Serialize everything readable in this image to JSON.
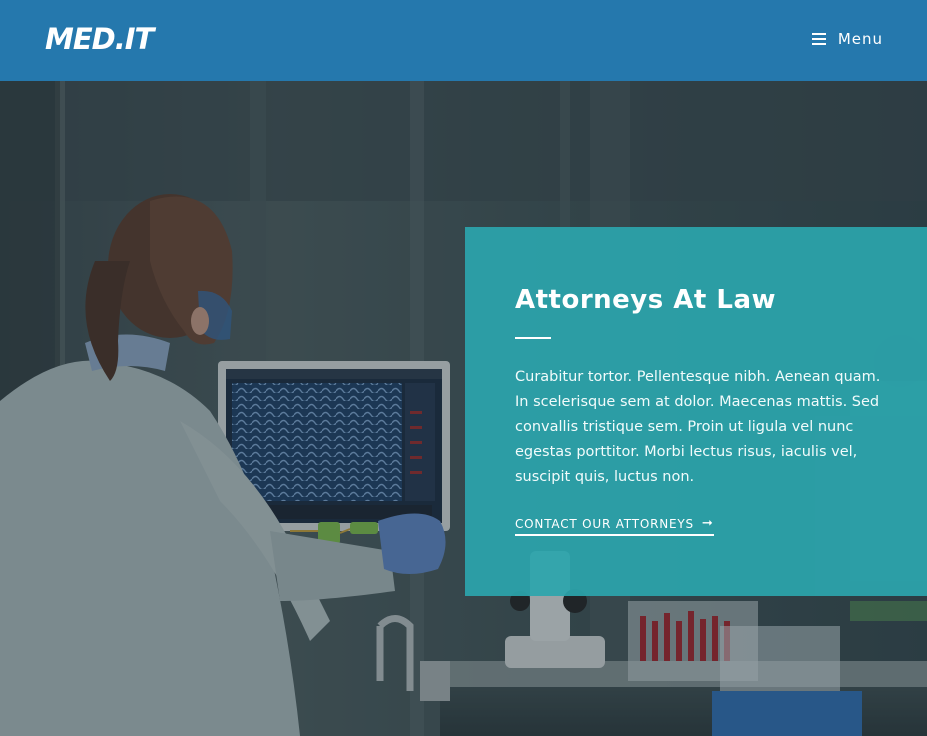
{
  "header": {
    "logo": "MED.IT",
    "menu_label": "Menu",
    "menu_icon": "hamburger-icon"
  },
  "hero": {
    "background": "lab-scientist-photo"
  },
  "card": {
    "title": "Attorneys At Law",
    "body": "Curabitur tortor. Pellentesque nibh. Aenean quam. In scelerisque sem at dolor. Maecenas mattis. Sed convallis tristique sem. Proin ut ligula vel nunc egestas porttitor. Morbi lectus risus, iaculis vel, suscipit quis, luctus non.",
    "link_label": "CONTACT OUR ATTORNEYS",
    "link_icon": "arrow-right-icon"
  },
  "colors": {
    "header_bg": "#2578ad",
    "card_bg": "#2ba5ac",
    "text": "#ffffff"
  }
}
